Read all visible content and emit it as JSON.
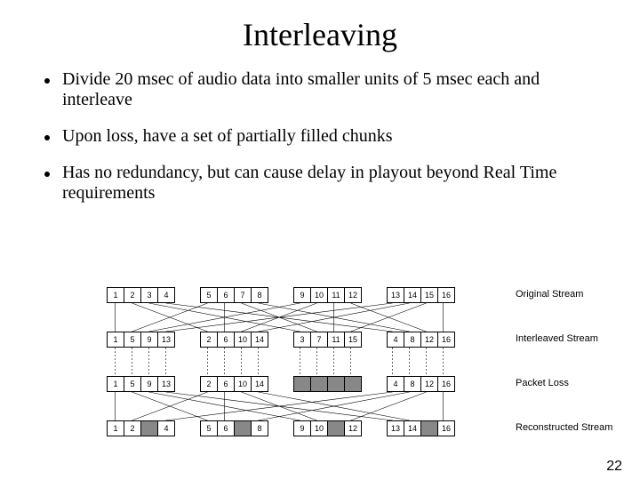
{
  "title": "Interleaving",
  "bullets": [
    "Divide 20 msec of audio data into smaller units of 5 msec each and interleave",
    "Upon loss, have a set of partially filled chunks",
    "Has no redundancy, but can cause delay in playout beyond Real Time requirements"
  ],
  "rows": [
    {
      "label": "Original Stream",
      "groups": [
        [
          "1",
          "2",
          "3",
          "4"
        ],
        [
          "5",
          "6",
          "7",
          "8"
        ],
        [
          "9",
          "10",
          "11",
          "12"
        ],
        [
          "13",
          "14",
          "15",
          "16"
        ]
      ],
      "lost": []
    },
    {
      "label": "Interleaved Stream",
      "groups": [
        [
          "1",
          "5",
          "9",
          "13"
        ],
        [
          "2",
          "6",
          "10",
          "14"
        ],
        [
          "3",
          "7",
          "11",
          "15"
        ],
        [
          "4",
          "8",
          "12",
          "16"
        ]
      ],
      "lost": []
    },
    {
      "label": "Packet Loss",
      "groups": [
        [
          "1",
          "5",
          "9",
          "13"
        ],
        [
          "2",
          "6",
          "10",
          "14"
        ],
        [
          "",
          "",
          "",
          ""
        ],
        [
          "4",
          "8",
          "12",
          "16"
        ]
      ],
      "lost": [
        8,
        9,
        10,
        11
      ]
    },
    {
      "label": "Reconstructed Stream",
      "groups": [
        [
          "1",
          "2",
          "",
          "4"
        ],
        [
          "5",
          "6",
          "",
          "8"
        ],
        [
          "9",
          "10",
          "",
          "12"
        ],
        [
          "13",
          "14",
          "",
          "16"
        ]
      ],
      "lost": [
        2,
        6,
        10,
        14
      ]
    }
  ],
  "page": "22"
}
